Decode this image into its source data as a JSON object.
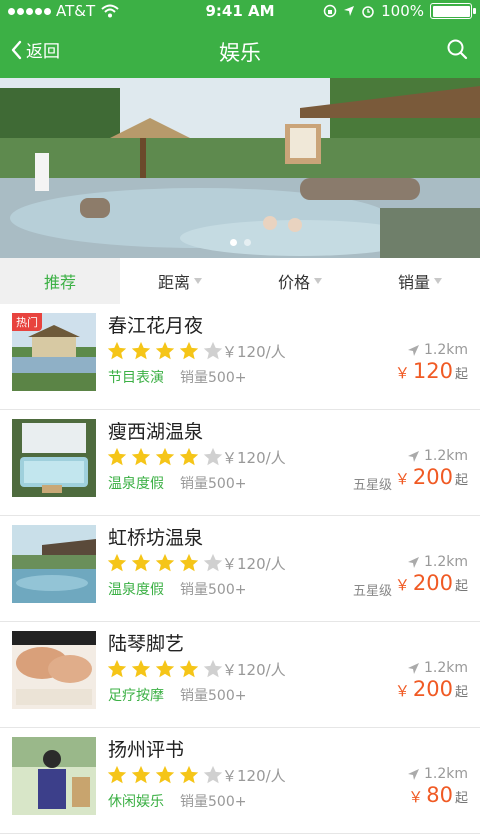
{
  "status_bar": {
    "carrier": "AT&T",
    "time": "9:41 AM",
    "battery": "100%"
  },
  "nav": {
    "back_label": "返回",
    "title": "娱乐"
  },
  "banner": {
    "pages": 2,
    "active_page": 1
  },
  "tabs": [
    {
      "label": "推荐",
      "active": true
    },
    {
      "label": "距离",
      "active": false
    },
    {
      "label": "价格",
      "active": false
    },
    {
      "label": "销量",
      "active": false
    }
  ],
  "items": [
    {
      "badge": "热门",
      "name": "春江花月夜",
      "rating": 4,
      "per_person": "￥120/人",
      "distance": "1.2km",
      "tag": "节目表演",
      "sales": "销量500+",
      "level": "",
      "currency": "￥",
      "price": "120",
      "price_suffix": "起"
    },
    {
      "badge": "",
      "name": "瘦西湖温泉",
      "rating": 4,
      "per_person": "￥120/人",
      "distance": "1.2km",
      "tag": "温泉度假",
      "sales": "销量500+",
      "level": "五星级",
      "currency": "￥",
      "price": "200",
      "price_suffix": "起"
    },
    {
      "badge": "",
      "name": "虹桥坊温泉",
      "rating": 4,
      "per_person": "￥120/人",
      "distance": "1.2km",
      "tag": "温泉度假",
      "sales": "销量500+",
      "level": "五星级",
      "currency": "￥",
      "price": "200",
      "price_suffix": "起"
    },
    {
      "badge": "",
      "name": "陆琴脚艺",
      "rating": 4,
      "per_person": "￥120/人",
      "distance": "1.2km",
      "tag": "足疗按摩",
      "sales": "销量500+",
      "level": "",
      "currency": "￥",
      "price": "200",
      "price_suffix": "起"
    },
    {
      "badge": "",
      "name": "扬州评书",
      "rating": 4,
      "per_person": "￥120/人",
      "distance": "1.2km",
      "tag": "休闲娱乐",
      "sales": "销量500+",
      "level": "",
      "currency": "￥",
      "price": "80",
      "price_suffix": "起"
    }
  ],
  "colors": {
    "brand": "#3cb045",
    "price": "#f05a24",
    "star_on": "#f5c518",
    "star_off": "#d0d0d0",
    "badge": "#e8433e"
  }
}
